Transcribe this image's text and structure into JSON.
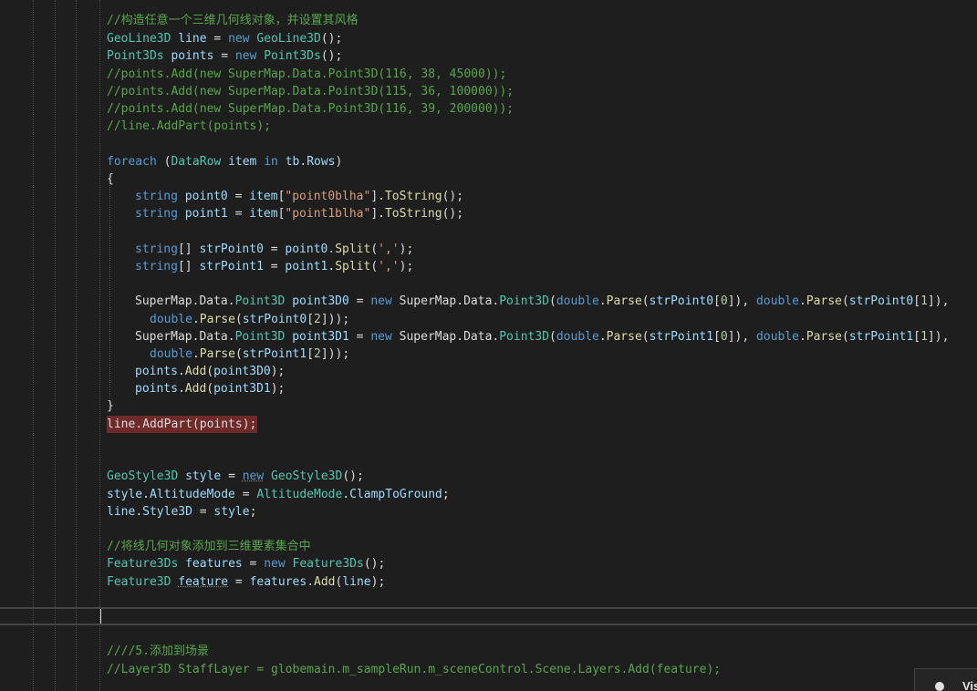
{
  "code": {
    "l1": "//构造任意一个三维几何线对象，并设置其风格",
    "l2_type": "GeoLine3D",
    "l2_var": "line",
    "l2_eq": " = ",
    "l2_new": "new",
    "l2_ctor": "GeoLine3D",
    "l2_end": "();",
    "l3_type": "Point3Ds",
    "l3_var": "points",
    "l3_ctor": "Point3Ds",
    "l4": "//points.Add(new SuperMap.Data.Point3D(116, 38, 45000));",
    "l5": "//points.Add(new SuperMap.Data.Point3D(115, 36, 100000));",
    "l6": "//points.Add(new SuperMap.Data.Point3D(116, 39, 200000));",
    "l7": "//line.AddPart(points);",
    "foreach_kw": "foreach",
    "foreach_open": " (",
    "foreach_type": "DataRow",
    "foreach_item": "item",
    "foreach_in": "in",
    "foreach_tb": "tb",
    "foreach_rows": "Rows",
    "foreach_close": ")",
    "brace_open": "{",
    "brace_close": "}",
    "kw_string": "string",
    "v_point0": "point0",
    "v_point1": "point1",
    "v_item": "item",
    "s_point0": "\"point0blha\"",
    "s_point1": "\"point1blha\"",
    "m_tostring": "ToString",
    "v_strPoint0": "strPoint0",
    "v_strPoint1": "strPoint1",
    "m_split": "Split",
    "s_comma": "','",
    "ns_supermap": "SuperMap",
    "ns_data": "Data",
    "t_point3d": "Point3D",
    "v_point3D0": "point3D0",
    "v_point3D1": "point3D1",
    "kw_new": "new",
    "kw_double": "double",
    "m_parse": "Parse",
    "idx0": "0",
    "idx1": "1",
    "idx2": "2",
    "v_points": "points",
    "m_add": "Add",
    "err_line": "line.AddPart(points);",
    "t_geostyle3d": "GeoStyle3D",
    "v_style": "style",
    "v_altmode": "AltitudeMode",
    "t_altmode": "AltitudeMode",
    "v_clamp": "ClampToGround",
    "v_line": "line",
    "v_style3d": "Style3D",
    "c_add_feature": "//将线几何对象添加到三维要素集合中",
    "t_feature3ds": "Feature3Ds",
    "v_features": "features",
    "t_feature3d": "Feature3D",
    "v_feature": "feature",
    "c_scene": "////5.添加到场景",
    "c_layer": "//Layer3D StaffLayer = globemain.m_sampleRun.m_sceneControl.Scene.Layers.Add(feature);"
  },
  "popup": {
    "text": "Vis"
  }
}
